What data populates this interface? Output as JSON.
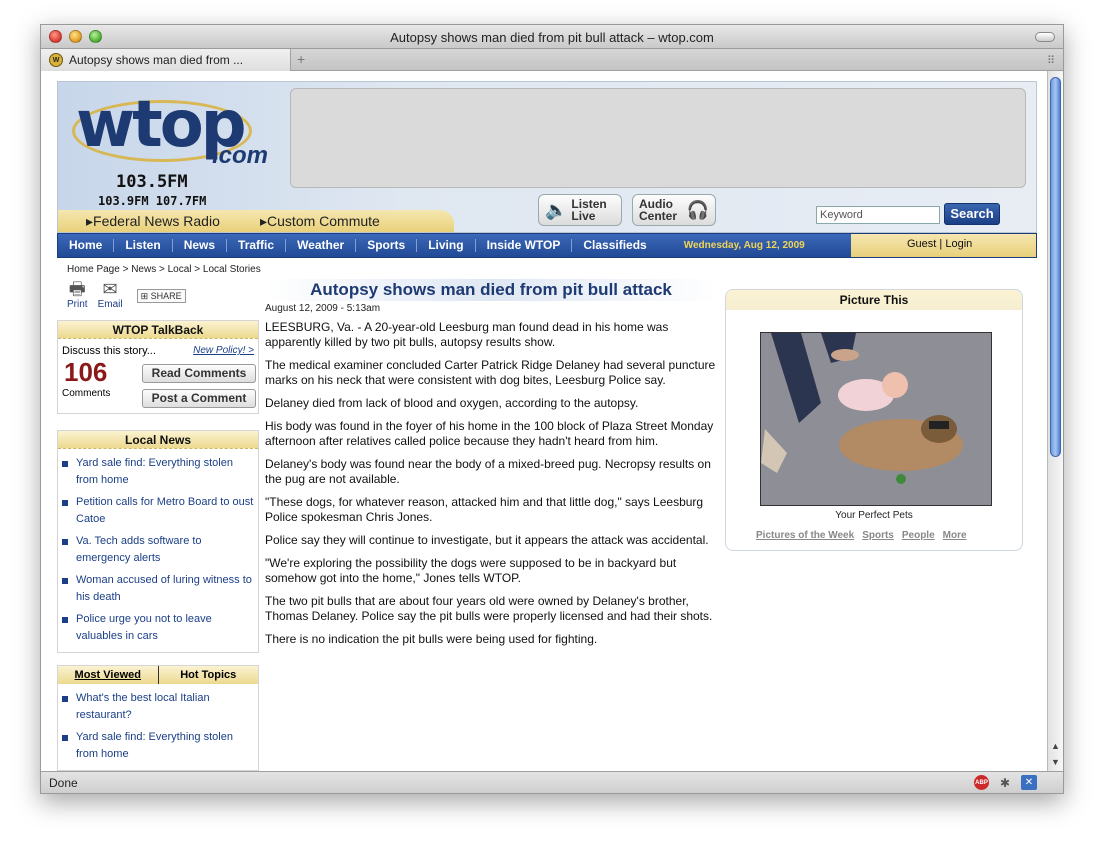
{
  "window": {
    "title": "Autopsy shows man died from pit bull attack – wtop.com"
  },
  "tab": {
    "title": "Autopsy shows man died from ..."
  },
  "status": {
    "text": "Done"
  },
  "site": {
    "logo_wtop": "wtop",
    "logo_com": ".com",
    "freq_main": "103.5FM",
    "freq_alt": "103.9FM 107.7FM",
    "strip_left": "▸Federal News Radio",
    "strip_right": "▸Custom Commute",
    "listen_live": "Listen Live",
    "audio_center": "Audio Center",
    "search_placeholder": "Keyword",
    "search_button": "Search"
  },
  "nav": {
    "items": [
      "Home",
      "Listen",
      "News",
      "Traffic",
      "Weather",
      "Sports",
      "Living",
      "Inside WTOP",
      "Classifieds"
    ],
    "date": "Wednesday, Aug 12, 2009",
    "guest": "Guest",
    "login": "Login"
  },
  "breadcrumb": "Home Page > News > Local > Local Stories",
  "tools": {
    "print": "Print",
    "email": "Email",
    "share": "SHARE"
  },
  "talkback": {
    "title": "WTOP TalkBack",
    "discuss": "Discuss this story...",
    "policy": "New Policy! >",
    "count": "106",
    "count_label": "Comments",
    "read": "Read Comments",
    "post": "Post a Comment"
  },
  "local_news": {
    "title": "Local News",
    "items": [
      "Yard sale find: Everything stolen from home",
      "Petition calls for Metro Board to oust Catoe",
      "Va. Tech adds software to emergency alerts",
      "Woman accused of luring witness to his death",
      "Police urge you not to leave valuables in cars"
    ]
  },
  "most_viewed": {
    "tab_active": "Most Viewed",
    "tab_other": "Hot Topics",
    "items": [
      "What's the best local Italian restaurant?",
      "Yard sale find: Everything stolen from home"
    ]
  },
  "article": {
    "headline": "Autopsy shows man died from pit bull attack",
    "date": "August 12, 2009 - 5:13am",
    "paragraphs": [
      "LEESBURG, Va. - A 20-year-old Leesburg man found dead in his home was apparently killed by two pit bulls, autopsy results show.",
      "The medical examiner concluded Carter Patrick Ridge Delaney had several puncture marks on his neck that were consistent with dog bites, Leesburg Police say.",
      "Delaney died from lack of blood and oxygen, according to the autopsy.",
      "His body was found in the foyer of his home in the 100 block of Plaza Street Monday afternoon after relatives called police because they hadn't heard from him.",
      "Delaney's body was found near the body of a mixed-breed pug. Necropsy results on the pug are not available.",
      "\"These dogs, for whatever reason, attacked him and that little dog,\" says Leesburg Police spokesman Chris Jones.",
      "Police say they will continue to investigate, but it appears the attack was accidental.",
      "\"We're exploring the possibility the dogs were supposed to be in backyard but somehow got into the home,\" Jones tells WTOP.",
      "The two pit bulls that are about four years old were owned by Delaney's brother, Thomas Delaney. Police say the pit bulls were properly licensed and had their shots.",
      "There is no indication the pit bulls were being used for fighting."
    ]
  },
  "picture": {
    "title": "Picture This",
    "caption": "Your Perfect Pets",
    "links": [
      "Pictures of the Week",
      "Sports",
      "People",
      "More"
    ]
  }
}
